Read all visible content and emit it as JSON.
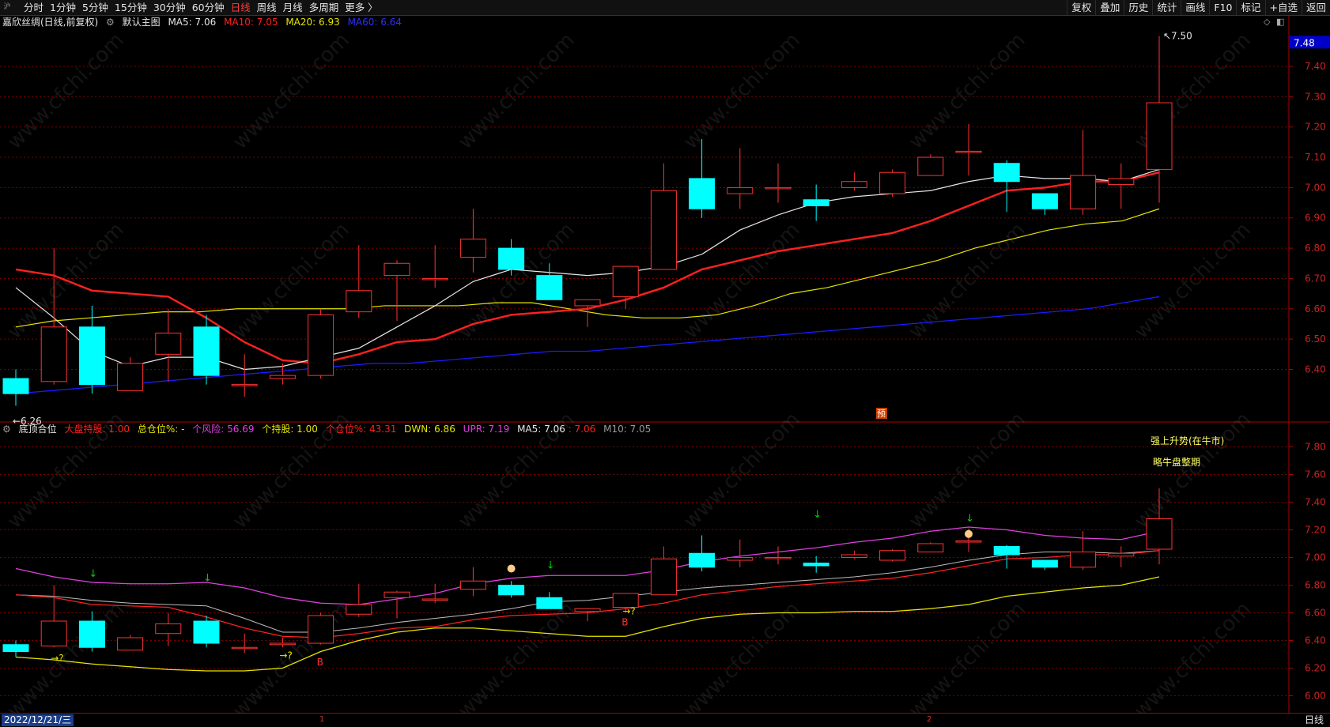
{
  "app": {
    "logo": "沪"
  },
  "periods": [
    "分时",
    "1分钟",
    "5分钟",
    "15分钟",
    "30分钟",
    "60分钟",
    "日线",
    "周线",
    "月线",
    "多周期",
    "更多 〉"
  ],
  "active_period": "日线",
  "tools": [
    "复权",
    "叠加",
    "历史",
    "统计",
    "画线",
    "F10",
    "标记",
    "+自选",
    "返回"
  ],
  "main": {
    "title": "嘉欣丝绸(日线,前复权)",
    "indicator": "默认主图",
    "ma5": "MA5: 7.06",
    "ma10": "MA10: 7.05",
    "ma20": "MA20: 6.93",
    "ma60": "MA60: 6.64",
    "last_price": "7.48",
    "high_label": "7.50",
    "low_label": "6.26",
    "badge": "预",
    "axis": [
      "7.40",
      "7.30",
      "7.20",
      "7.10",
      "7.00",
      "6.90",
      "6.80",
      "6.70",
      "6.60",
      "6.50",
      "6.40"
    ]
  },
  "sub": {
    "name": "底顶合位",
    "f1": "大盘持股: 1.00",
    "f2": "总仓位%: -",
    "f3": "个风险: 56.69",
    "f4": "个持股: 1.00",
    "f5": "个仓位%: 43.31",
    "f6": "DWN: 6.86",
    "f7": "UPR: 7.19",
    "f8": "MA5: 7.06",
    "f9": ": 7.06",
    "f10": "M10: 7.05",
    "note1": "强上升势(在牛市)",
    "note2": "略牛盘整期",
    "axis": [
      "7.80",
      "7.60",
      "7.40",
      "7.20",
      "7.00",
      "6.80",
      "6.60",
      "6.40",
      "6.20",
      "6.00"
    ],
    "signals": {
      "arrow_right_q": "→?",
      "buy": "B",
      "down": "↓"
    }
  },
  "bottom": {
    "date": "2022/12/21/三",
    "mark1": "1",
    "mark2": "2",
    "period": "日线"
  },
  "watermark": "www.cfchi.com",
  "colors": {
    "up": "#ff3232",
    "down": "#00ffff",
    "ma5": "#e6e6e6",
    "ma10": "#ff2020",
    "ma20": "#e6e600",
    "ma60": "#1a1aff",
    "upr": "#e040e0",
    "dwn": "#e6e600",
    "grid": "#7a0000"
  },
  "chart_data": {
    "type": "candlestick",
    "candles": [
      {
        "o": 6.37,
        "c": 6.32,
        "h": 6.4,
        "l": 6.28
      },
      {
        "o": 6.36,
        "c": 6.54,
        "h": 6.8,
        "l": 6.35
      },
      {
        "o": 6.54,
        "c": 6.35,
        "h": 6.61,
        "l": 6.32
      },
      {
        "o": 6.33,
        "c": 6.42,
        "h": 6.44,
        "l": 6.33
      },
      {
        "o": 6.45,
        "c": 6.52,
        "h": 6.6,
        "l": 6.36
      },
      {
        "o": 6.54,
        "c": 6.38,
        "h": 6.58,
        "l": 6.35
      },
      {
        "o": 6.35,
        "c": 6.35,
        "h": 6.45,
        "l": 6.31
      },
      {
        "o": 6.37,
        "c": 6.38,
        "h": 6.42,
        "l": 6.35
      },
      {
        "o": 6.38,
        "c": 6.58,
        "h": 6.6,
        "l": 6.37
      },
      {
        "o": 6.59,
        "c": 6.66,
        "h": 6.81,
        "l": 6.57
      },
      {
        "o": 6.71,
        "c": 6.75,
        "h": 6.76,
        "l": 6.56
      },
      {
        "o": 6.7,
        "c": 6.7,
        "h": 6.81,
        "l": 6.67
      },
      {
        "o": 6.77,
        "c": 6.83,
        "h": 6.93,
        "l": 6.72
      },
      {
        "o": 6.8,
        "c": 6.73,
        "h": 6.83,
        "l": 6.71
      },
      {
        "o": 6.71,
        "c": 6.63,
        "h": 6.75,
        "l": 6.63
      },
      {
        "o": 6.61,
        "c": 6.63,
        "h": 6.63,
        "l": 6.54
      },
      {
        "o": 6.64,
        "c": 6.74,
        "h": 6.74,
        "l": 6.6
      },
      {
        "o": 6.73,
        "c": 6.99,
        "h": 7.08,
        "l": 6.73
      },
      {
        "o": 7.03,
        "c": 6.93,
        "h": 7.16,
        "l": 6.9
      },
      {
        "o": 6.98,
        "c": 7.0,
        "h": 7.13,
        "l": 6.93
      },
      {
        "o": 7.0,
        "c": 7.0,
        "h": 7.08,
        "l": 6.95
      },
      {
        "o": 6.96,
        "c": 6.94,
        "h": 7.01,
        "l": 6.89
      },
      {
        "o": 7.0,
        "c": 7.02,
        "h": 7.05,
        "l": 6.99
      },
      {
        "o": 6.98,
        "c": 7.05,
        "h": 7.06,
        "l": 6.97
      },
      {
        "o": 7.04,
        "c": 7.1,
        "h": 7.11,
        "l": 7.04
      },
      {
        "o": 7.12,
        "c": 7.12,
        "h": 7.21,
        "l": 7.04
      },
      {
        "o": 7.08,
        "c": 7.02,
        "h": 7.09,
        "l": 6.92
      },
      {
        "o": 6.98,
        "c": 6.93,
        "h": 6.98,
        "l": 6.91
      },
      {
        "o": 6.93,
        "c": 7.04,
        "h": 7.19,
        "l": 6.91
      },
      {
        "o": 7.01,
        "c": 7.03,
        "h": 7.08,
        "l": 6.93
      },
      {
        "o": 7.06,
        "c": 7.28,
        "h": 7.5,
        "l": 6.95
      }
    ],
    "ma5": [
      6.67,
      6.57,
      6.46,
      6.41,
      6.44,
      6.44,
      6.4,
      6.41,
      6.44,
      6.47,
      6.54,
      6.61,
      6.69,
      6.73,
      6.72,
      6.71,
      6.72,
      6.74,
      6.78,
      6.86,
      6.91,
      6.95,
      6.97,
      6.98,
      6.99,
      7.02,
      7.04,
      7.03,
      7.03,
      7.02,
      7.06
    ],
    "ma10": [
      6.73,
      6.71,
      6.66,
      6.65,
      6.64,
      6.57,
      6.49,
      6.43,
      6.42,
      6.45,
      6.49,
      6.5,
      6.55,
      6.58,
      6.59,
      6.6,
      6.63,
      6.67,
      6.73,
      6.76,
      6.79,
      6.81,
      6.83,
      6.85,
      6.89,
      6.94,
      6.99,
      7.0,
      7.02,
      7.02,
      7.05
    ],
    "ma20": [
      6.54,
      6.56,
      6.57,
      6.58,
      6.59,
      6.59,
      6.6,
      6.6,
      6.6,
      6.6,
      6.61,
      6.61,
      6.61,
      6.62,
      6.62,
      6.6,
      6.58,
      6.57,
      6.57,
      6.58,
      6.61,
      6.65,
      6.67,
      6.7,
      6.73,
      6.76,
      6.8,
      6.83,
      6.86,
      6.88,
      6.89,
      6.93
    ],
    "ma60": [
      6.32,
      6.33,
      6.34,
      6.35,
      6.36,
      6.37,
      6.38,
      6.39,
      6.4,
      6.41,
      6.42,
      6.42,
      6.43,
      6.44,
      6.45,
      6.46,
      6.46,
      6.47,
      6.48,
      6.49,
      6.5,
      6.51,
      6.52,
      6.53,
      6.54,
      6.55,
      6.56,
      6.57,
      6.58,
      6.59,
      6.6,
      6.62,
      6.64
    ],
    "upr": [
      6.92,
      6.86,
      6.82,
      6.81,
      6.81,
      6.82,
      6.78,
      6.71,
      6.67,
      6.66,
      6.7,
      6.74,
      6.81,
      6.85,
      6.87,
      6.87,
      6.87,
      6.91,
      6.97,
      7.01,
      7.04,
      7.07,
      7.11,
      7.14,
      7.19,
      7.22,
      7.2,
      7.16,
      7.14,
      7.13,
      7.19
    ],
    "dwn": [
      6.28,
      6.26,
      6.23,
      6.21,
      6.19,
      6.18,
      6.18,
      6.2,
      6.32,
      6.4,
      6.46,
      6.49,
      6.49,
      6.47,
      6.45,
      6.43,
      6.43,
      6.5,
      6.56,
      6.59,
      6.6,
      6.6,
      6.61,
      6.61,
      6.63,
      6.66,
      6.72,
      6.75,
      6.78,
      6.8,
      6.86
    ],
    "mid": [
      6.73,
      6.72,
      6.69,
      6.67,
      6.66,
      6.65,
      6.56,
      6.46,
      6.46,
      6.49,
      6.53,
      6.56,
      6.59,
      6.63,
      6.68,
      6.69,
      6.72,
      6.75,
      6.78,
      6.8,
      6.82,
      6.84,
      6.86,
      6.89,
      6.93,
      6.98,
      7.02,
      7.04,
      7.04,
      7.03,
      7.05
    ],
    "main_ylim": [
      6.25,
      7.52
    ],
    "sub_ylim": [
      5.9,
      7.9
    ]
  }
}
